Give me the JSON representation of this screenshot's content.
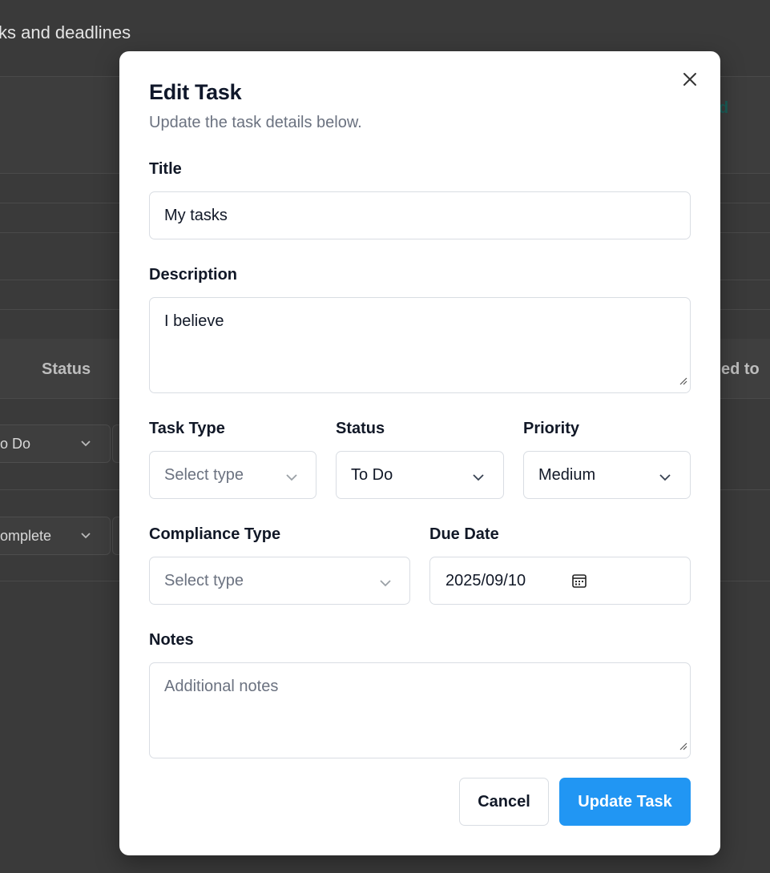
{
  "background": {
    "subtitle": "ks and deadlines",
    "right_header_fragment": "d",
    "table_header_status": "Status",
    "table_header_assigned": "ed to",
    "row1_status": "o Do",
    "row2_status": "omplete"
  },
  "modal": {
    "title": "Edit Task",
    "description": "Update the task details below.",
    "close_icon": "close-icon",
    "fields": {
      "title": {
        "label": "Title",
        "value": "My tasks"
      },
      "description": {
        "label": "Description",
        "value": "I believe"
      },
      "task_type": {
        "label": "Task Type",
        "value": "",
        "placeholder": "Select type"
      },
      "status": {
        "label": "Status",
        "value": "To Do"
      },
      "priority": {
        "label": "Priority",
        "value": "Medium"
      },
      "compliance_type": {
        "label": "Compliance Type",
        "value": "",
        "placeholder": "Select type"
      },
      "due_date": {
        "label": "Due Date",
        "value": "2025/09/10"
      },
      "notes": {
        "label": "Notes",
        "value": "",
        "placeholder": "Additional notes"
      }
    },
    "buttons": {
      "cancel": "Cancel",
      "update": "Update Task"
    }
  },
  "colors": {
    "primary": "#2196f3",
    "overlay": "#3a3a3a",
    "border": "#d9dde3",
    "muted_text": "#6b7280"
  }
}
